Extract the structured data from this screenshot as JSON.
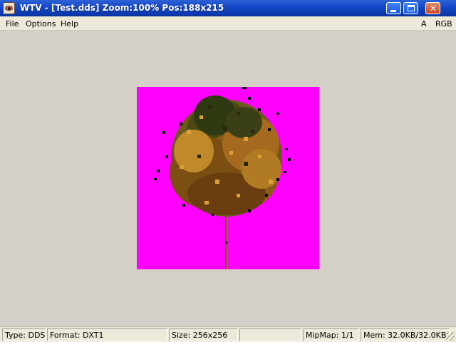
{
  "window": {
    "title": "WTV - [Test.dds] Zoom:100% Pos:188x215"
  },
  "menu": {
    "file": "File",
    "options": "Options",
    "help": "Help",
    "channel_alpha": "A",
    "channel_rgb": "RGB"
  },
  "image": {
    "background_color": "#ff00ff",
    "content": "tree texture"
  },
  "status": {
    "type": "Type: DDS",
    "format": "Format: DXT1",
    "size": "Size: 256x256",
    "empty": "",
    "mipmap": "MipMap: 1/1",
    "mem": "Mem: 32.0KB/32.0KB"
  }
}
